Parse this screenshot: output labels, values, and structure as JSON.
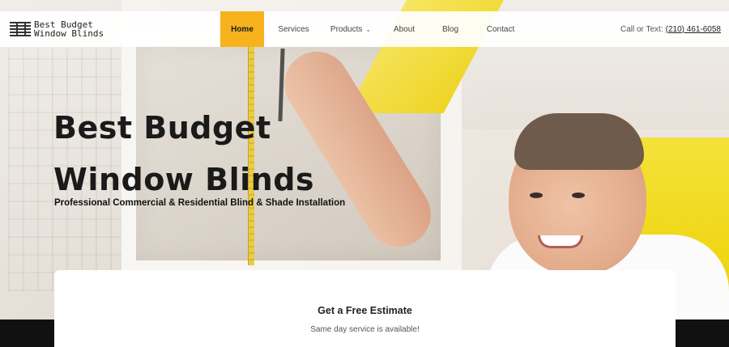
{
  "brand": {
    "line1": "Best Budget",
    "line2": "Window Blinds",
    "logo_icon": "window-blinds-icon"
  },
  "nav": {
    "items": [
      {
        "label": "Home",
        "active": true
      },
      {
        "label": "Services",
        "active": false
      },
      {
        "label": "Products",
        "active": false,
        "has_dropdown": true
      },
      {
        "label": "About",
        "active": false
      },
      {
        "label": "Blog",
        "active": false
      },
      {
        "label": "Contact",
        "active": false
      }
    ],
    "dropdown_glyph": "⌄"
  },
  "contact": {
    "prefix": "Call or Text:",
    "phone": "(210) 461-6058"
  },
  "hero": {
    "title_line1": "Best Budget",
    "title_line2": "Window Blinds",
    "subtitle": "Professional Commercial & Residential Blind & Shade Installation"
  },
  "estimate": {
    "title": "Get a Free Estimate",
    "subtitle": "Same day service is available!"
  },
  "colors": {
    "accent": "#f7b21e",
    "text_dark": "#1a1a1a"
  }
}
